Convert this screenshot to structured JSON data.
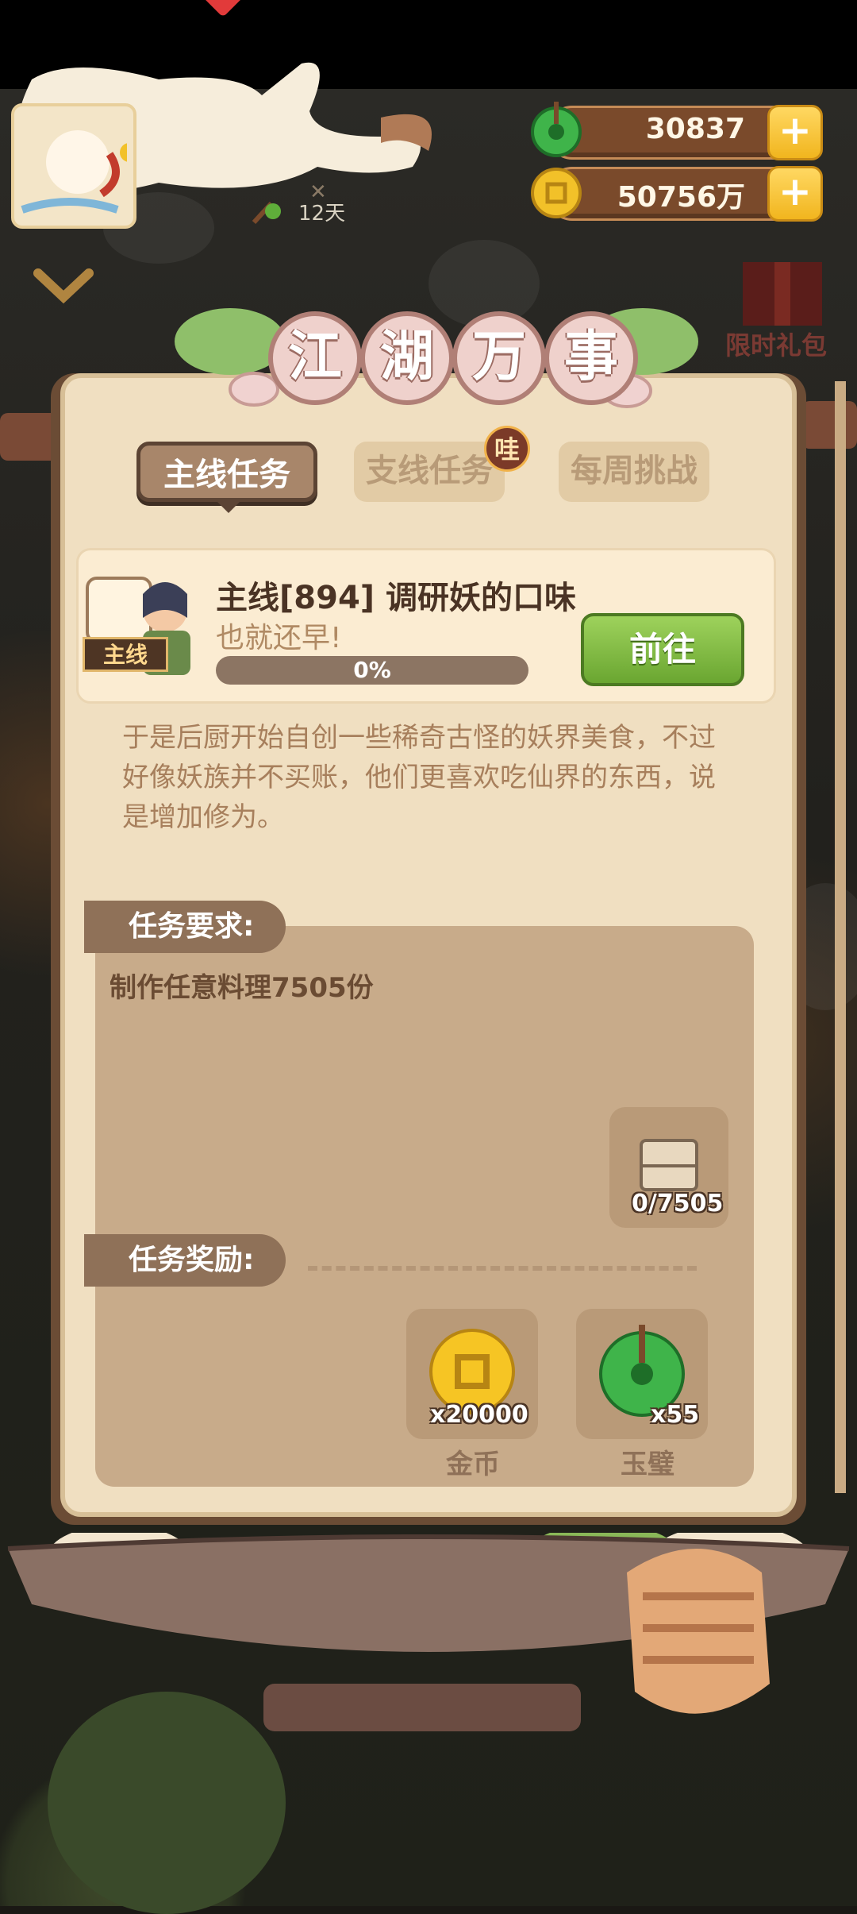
{
  "header": {
    "currencies": [
      {
        "name": "jade",
        "value": "30837",
        "color": "#3fb44a"
      },
      {
        "name": "gold",
        "value": "50756万",
        "color": "#f2c129"
      }
    ],
    "avatar_days": "12天"
  },
  "side": {
    "gift_label": "限时礼包"
  },
  "panel": {
    "title_chars": [
      "江",
      "湖",
      "万",
      "事"
    ],
    "tabs": [
      {
        "label": "主线任务",
        "active": true
      },
      {
        "label": "支线任务",
        "active": false
      },
      {
        "label": "每周挑战",
        "active": false
      }
    ],
    "tab_badge": "哇"
  },
  "quest": {
    "tag": "主线",
    "title": "主线[894] 调研妖的口味",
    "subtitle": "也就还早!",
    "progress_text": "0%",
    "progress": 0,
    "goto_label": "前往",
    "story": "于是后厨开始自创一些稀奇古怪的妖界美食，不过好像妖族并不买账，他们更喜欢吃仙界的东西，说是增加修为。"
  },
  "requirement": {
    "label": "任务要求:",
    "text": "制作任意料理7505份",
    "item_count": "0/7505"
  },
  "reward": {
    "label": "任务奖励:",
    "items": [
      {
        "name": "金币",
        "count": "x20000",
        "icon": "gold-coin-icon"
      },
      {
        "name": "玉璧",
        "count": "x55",
        "icon": "jade-disc-icon"
      }
    ]
  }
}
